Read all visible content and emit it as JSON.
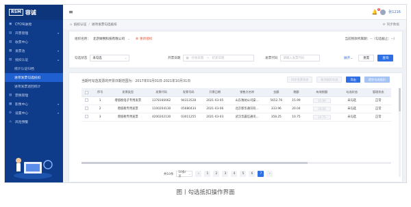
{
  "app": {
    "logo_mark": "RSM",
    "logo_text": "容诚"
  },
  "sidebar": {
    "items": [
      {
        "label": "CFO驾驶舱",
        "icon": "dashboard-icon",
        "chevron": ""
      },
      {
        "label": "开票管理",
        "icon": "invoice-icon",
        "chevron": "▾"
      },
      {
        "label": "收票中心",
        "icon": "inbox-icon",
        "chevron": ""
      },
      {
        "label": "发票池",
        "icon": "pool-icon",
        "chevron": "▾"
      },
      {
        "label": "抵扣认证",
        "icon": "certify-icon",
        "chevron": "▴"
      }
    ],
    "subitems": [
      {
        "label": "统计认证归档"
      },
      {
        "label": "进项发票勾选抵扣"
      },
      {
        "label": "进项发票退回统计"
      }
    ],
    "items2": [
      {
        "label": "票税管理",
        "icon": "tax-icon",
        "chevron": ""
      },
      {
        "label": "影像中心",
        "icon": "image-icon",
        "chevron": "▾"
      },
      {
        "label": "设置中心",
        "icon": "settings-icon",
        "chevron": "▾"
      },
      {
        "label": "风险预警",
        "icon": "risk-icon",
        "chevron": ""
      }
    ]
  },
  "topbar": {
    "menu_icon": "≡",
    "notification_count": "5",
    "user": "张1216"
  },
  "breadcrumb": {
    "home": "⌂",
    "level1": "抵扣认证",
    "level2": "进项发票勾选抵扣",
    "sync": "同步数据"
  },
  "filter": {
    "org_label": "组织名称：",
    "org_value": "北京财税科技有限公司",
    "switch_label": "重新授权",
    "period_text": "当前税款所属期：--（勾选截止：--）",
    "status_label": "勾选状态",
    "status_value": "未勾选",
    "date_label": "开票日期",
    "date_start_placeholder": "开始日期",
    "date_to": "～",
    "date_end_placeholder": "结束日期",
    "code_label": "发票代码",
    "code_placeholder": "请输入发票代码",
    "expand_label": "展开",
    "reset_label": "重置",
    "search_label": "查询"
  },
  "table_card": {
    "notice": "当期可勾选发票的开票日期范围为：2017年01月01日-2021年10月31日",
    "actions": [
      "同步发票状态",
      "取消抵扣勾选",
      "导出",
      "提交勾选抵扣"
    ],
    "columns": [
      "",
      "序号",
      "发票类型",
      "发票代码",
      "发票号码",
      "开票日期",
      "销售方名称",
      "金额",
      "税额",
      "有效税额",
      "勾选状态",
      "管理状态"
    ],
    "rows": [
      [
        "1",
        "增值税电子专用发票",
        "1378160062",
        "94313528",
        "2021-03-05",
        "山东潍坊公司安...",
        "5652.76",
        "15.99",
        "15.99",
        "未勾选",
        "正常"
      ],
      [
        "2",
        "增值税专用发票",
        "1100204130",
        "05680434",
        "2021-03-06",
        "北京新华通讯有...",
        "333.96",
        "20.04",
        "20.04",
        "未勾选",
        "正常"
      ],
      [
        "3",
        "增值税专用发票",
        "4200202130",
        "03011255",
        "2021-03-03",
        "武汉华晨信通讯...",
        "358.25",
        "10.75",
        "10.75",
        "未勾选",
        "正常"
      ]
    ]
  },
  "pager": {
    "total": "共10条",
    "page_size": "10条/页",
    "prev": "‹",
    "pages": [
      "1",
      "2",
      "3",
      "4",
      "5",
      "6",
      "7"
    ],
    "active_page": "7",
    "next": "›"
  },
  "caption": "图丨勾选抵扣操作界面",
  "colors": {
    "sidebar": "#0f3c8a",
    "active": "#1f5fd0",
    "primary": "#2f6fe6",
    "warn": "#e35a3a"
  }
}
